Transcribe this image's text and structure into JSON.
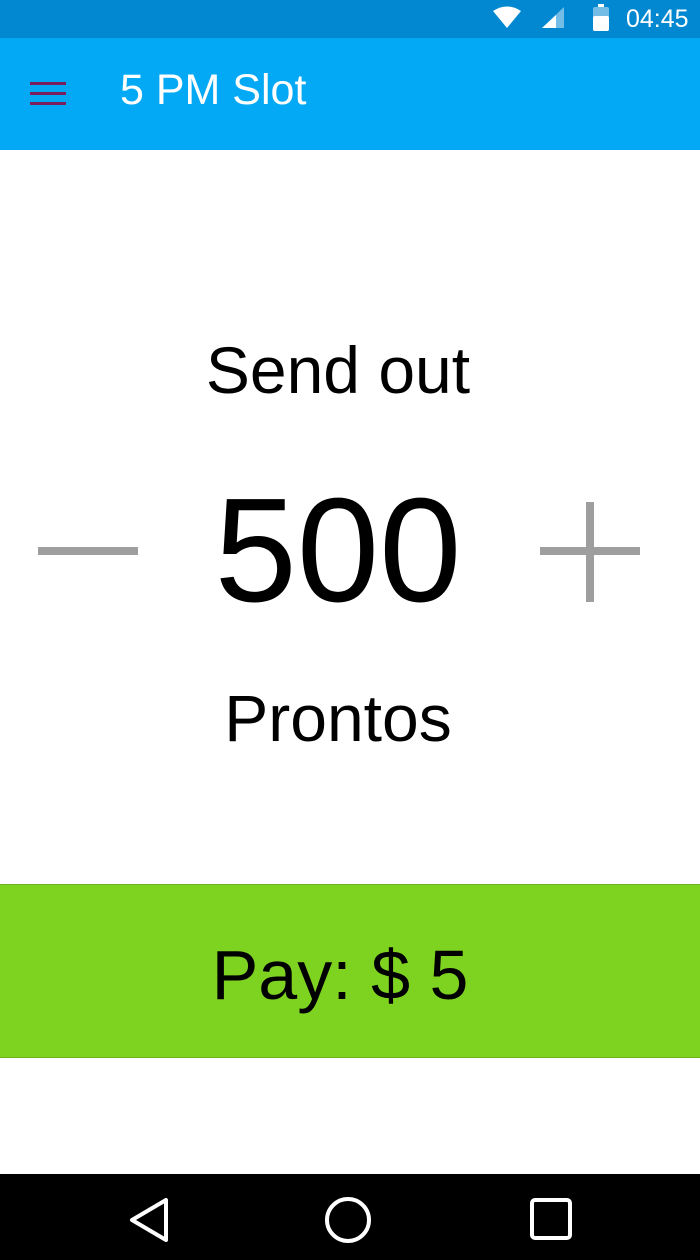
{
  "status_bar": {
    "time": "04:45",
    "icons": [
      "wifi-icon",
      "cell-signal-icon",
      "battery-icon"
    ]
  },
  "app_bar": {
    "menu_icon": "hamburger-menu-icon",
    "title": "5 PM Slot",
    "color": "#03a9f4"
  },
  "main": {
    "send_label": "Send out",
    "count": "500",
    "unit_label": "Prontos",
    "decrement_icon": "minus-icon",
    "increment_icon": "plus-icon"
  },
  "pay_button": {
    "label": "Pay: $ 5",
    "color": "#7ed321"
  },
  "nav_bar": {
    "icons": [
      "back-icon",
      "home-icon",
      "recents-icon"
    ]
  }
}
